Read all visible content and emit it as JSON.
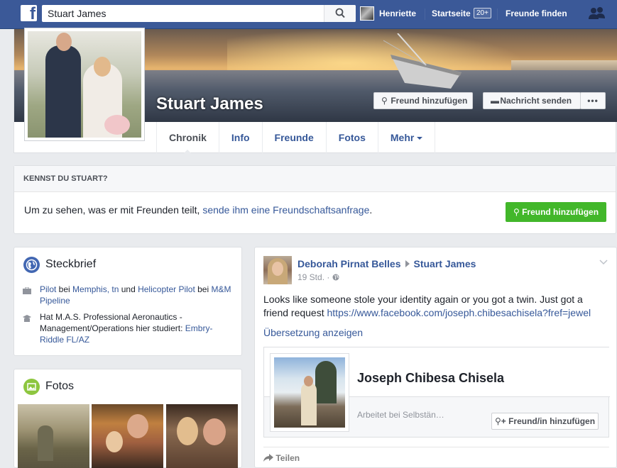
{
  "topbar": {
    "search_value": "Stuart James",
    "user_name": "Henriette",
    "home_label": "Startseite",
    "home_badge": "20+",
    "find_friends": "Freunde finden"
  },
  "profile": {
    "name": "Stuart James",
    "add_friend_label": "Freund hinzufügen",
    "message_label": "Nachricht senden",
    "more_label": "•••",
    "tabs": [
      {
        "label": "Chronik"
      },
      {
        "label": "Info"
      },
      {
        "label": "Freunde"
      },
      {
        "label": "Fotos"
      },
      {
        "label": "Mehr"
      }
    ]
  },
  "know": {
    "heading": "KENNST DU STUART?",
    "text_before": "Um zu sehen, was er mit Freunden teilt, ",
    "link": "sende ihm eine Freundschaftsanfrage",
    "text_after": ".",
    "button": "Freund hinzufügen"
  },
  "intro": {
    "title": "Steckbrief",
    "work": {
      "job1": "Pilot",
      "bei1": " bei ",
      "place1": "Memphis, tn",
      "und": " und ",
      "job2": "Helicopter Pilot",
      "bei2": " bei ",
      "place2": "M&M Pipeline"
    },
    "education": {
      "text": "Hat M.A.S. Professional Aeronautics - Management/Operations hier studiert: ",
      "school": "Embry-Riddle FL/AZ"
    }
  },
  "photos": {
    "title": "Fotos"
  },
  "post": {
    "author": "Deborah Pirnat Belles",
    "target": "Stuart James",
    "time": "19 Std. ·",
    "text": "Looks like someone stole your identity again or you got a twin. Just got a friend request ",
    "url": "https://www.facebook.com/joseph.chibesachisela?fref=jewel",
    "translate": "Übersetzung anzeigen",
    "shared_name": "Joseph Chibesa Chisela",
    "shared_works_prefix": "Arbeitet bei ",
    "shared_works_place": "Selbstän…",
    "shared_button": "Freund/in hinzufügen",
    "share_action": "Teilen"
  }
}
